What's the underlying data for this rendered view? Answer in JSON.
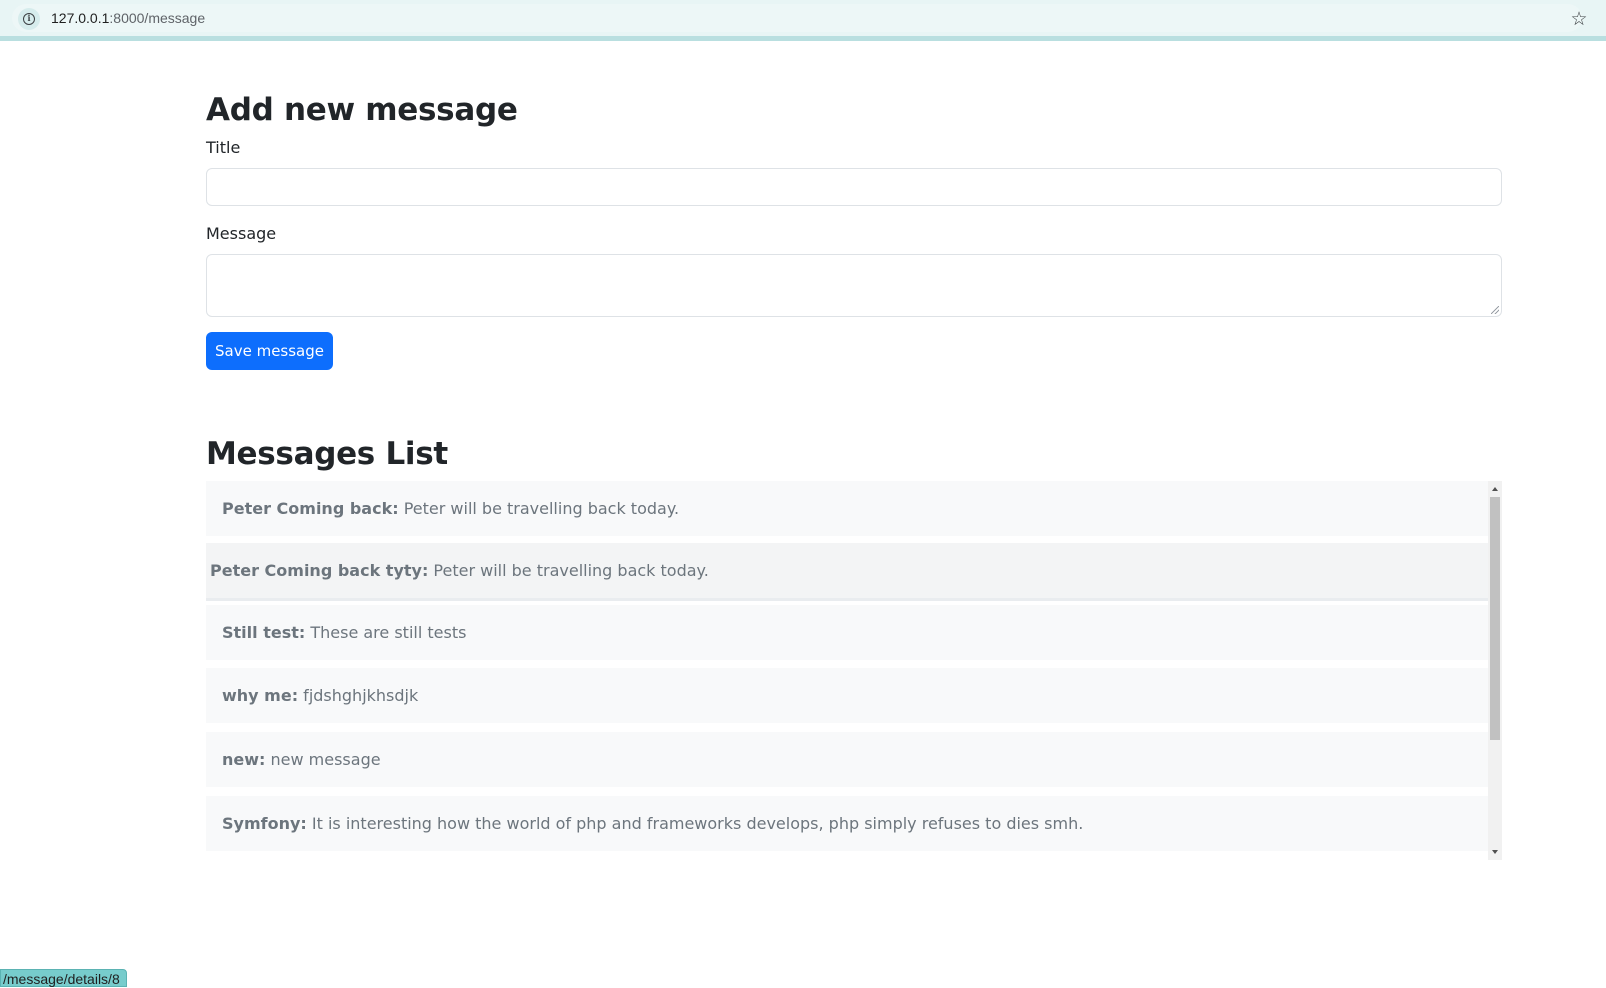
{
  "browser": {
    "url_host": "127.0.0.1",
    "url_rest": ":8000/message",
    "status_url": "/message/details/8"
  },
  "form": {
    "heading": "Add new message",
    "title_label": "Title",
    "title_value": "",
    "message_label": "Message",
    "message_value": "",
    "save_label": "Save message"
  },
  "list": {
    "heading": "Messages List",
    "items": [
      {
        "title": "Peter Coming back:",
        "body": " Peter will be travelling back today."
      },
      {
        "title": "Peter Coming back tyty:",
        "body": " Peter will be travelling back today."
      },
      {
        "title": "Still test:",
        "body": " These are still tests"
      },
      {
        "title": "why me:",
        "body": " fjdshghjkhsdjk"
      },
      {
        "title": "new:",
        "body": " new message"
      },
      {
        "title": "Symfony:",
        "body": " It is interesting how the world of php and frameworks develops, php simply refuses to dies smh."
      }
    ]
  },
  "colors": {
    "primary": "#0d6efd",
    "list_bg": "#f8f9fa",
    "muted_text": "#6c757d"
  }
}
